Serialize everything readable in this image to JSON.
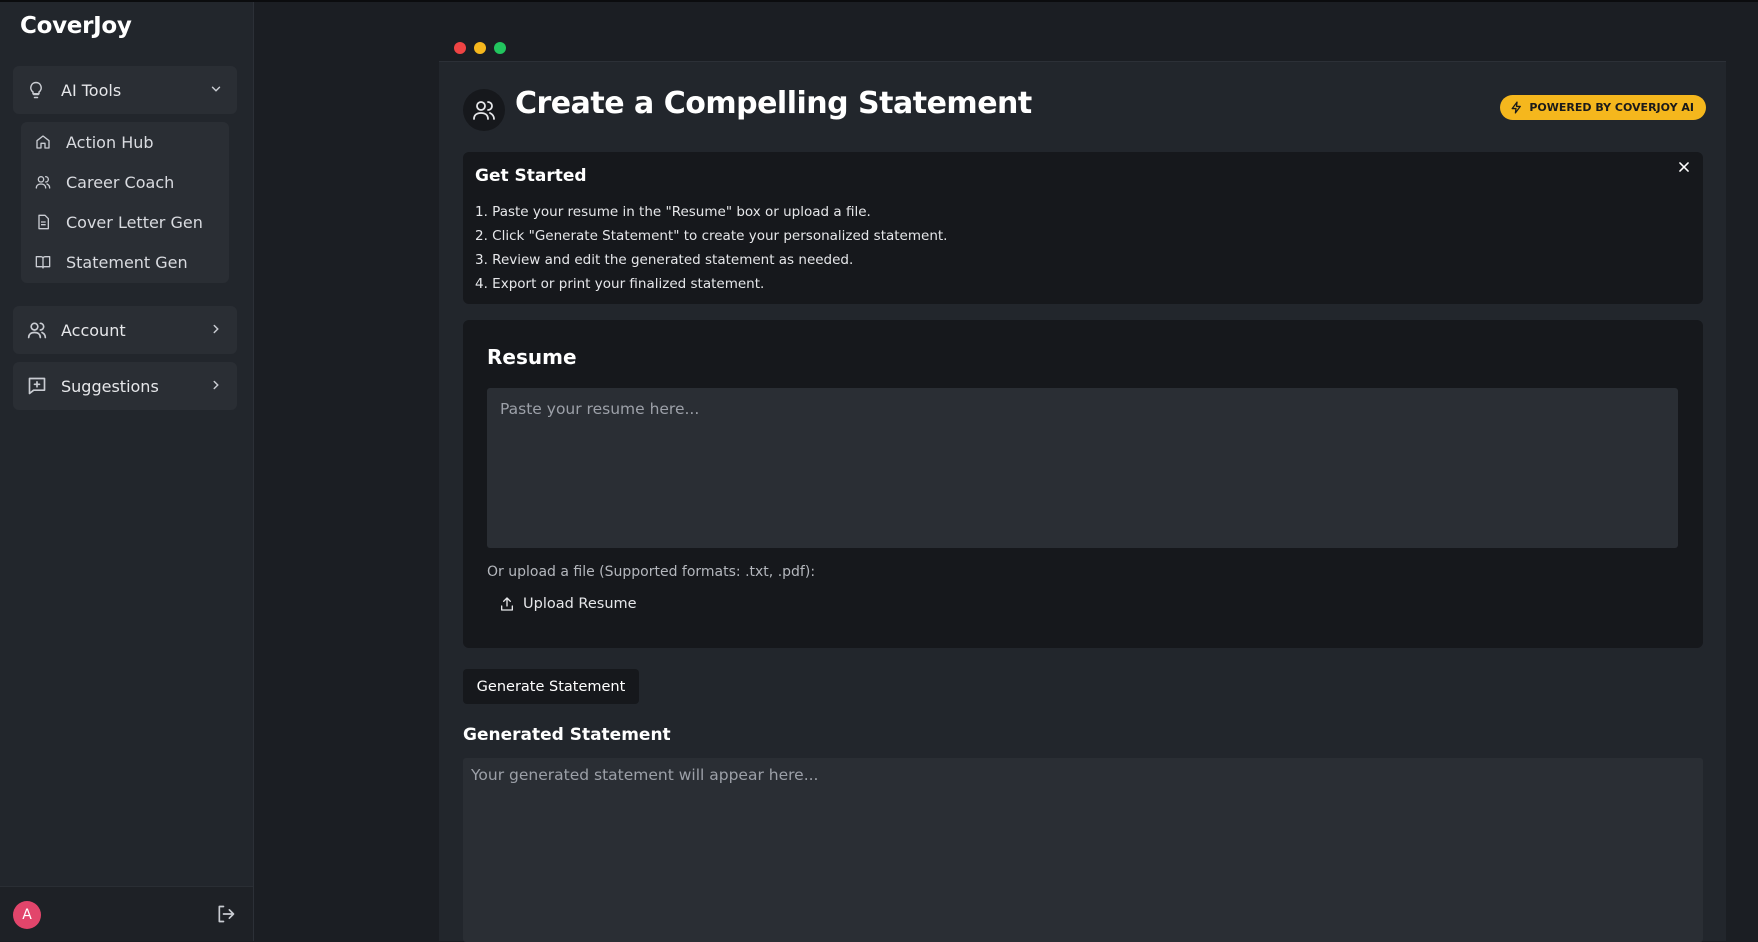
{
  "app": {
    "name": "CoverJoy"
  },
  "sidebar": {
    "ai_tools": {
      "label": "AI Tools",
      "icon": "lightbulb-icon",
      "items": [
        {
          "label": "Action Hub",
          "icon": "home-icon"
        },
        {
          "label": "Career Coach",
          "icon": "users-icon"
        },
        {
          "label": "Cover Letter Gen",
          "icon": "document-icon"
        },
        {
          "label": "Statement Gen",
          "icon": "book-icon"
        }
      ]
    },
    "account": {
      "label": "Account",
      "icon": "users-icon"
    },
    "suggestions": {
      "label": "Suggestions",
      "icon": "message-plus-icon"
    },
    "footer": {
      "avatar_initial": "A",
      "logout_icon": "logout-icon"
    }
  },
  "window": {
    "dots": [
      "#ef4444",
      "#f5b71d",
      "#22c55e"
    ]
  },
  "header": {
    "title": "Create a Compelling Statement",
    "badge": "POWERED BY COVERJOY AI"
  },
  "get_started": {
    "title": "Get Started",
    "steps": [
      "1. Paste your resume in the \"Resume\" box or upload a file.",
      "2. Click \"Generate Statement\" to create your personalized statement.",
      "3. Review and edit the generated statement as needed.",
      "4. Export or print your finalized statement."
    ]
  },
  "resume": {
    "title": "Resume",
    "placeholder": "Paste your resume here...",
    "value": "",
    "upload_note": "Or upload a file (Supported formats: .txt, .pdf):",
    "upload_label": "Upload Resume"
  },
  "generate": {
    "button_label": "Generate Statement"
  },
  "output": {
    "title": "Generated Statement",
    "placeholder": "Your generated statement will appear here...",
    "value": ""
  },
  "colors": {
    "accent": "#f5b71d",
    "avatar": "#e2456b",
    "background": "#1b1e23",
    "panel": "#22262c",
    "card": "#16181c"
  }
}
